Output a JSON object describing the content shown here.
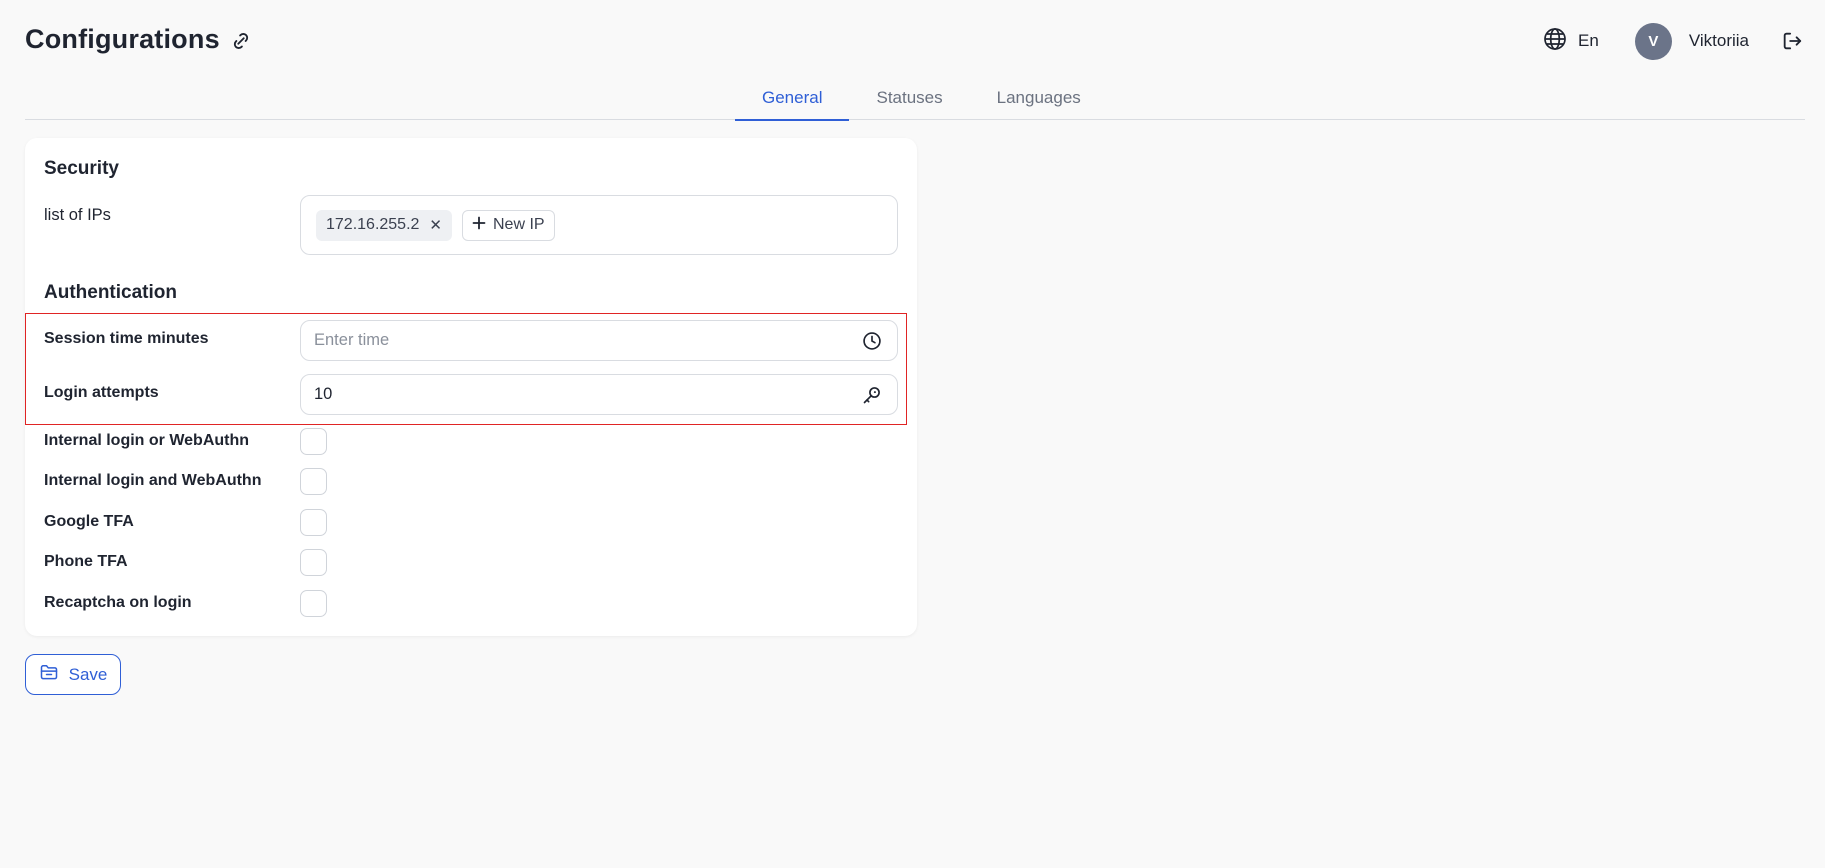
{
  "header": {
    "title": "Configurations",
    "language": "En",
    "user": {
      "initial": "V",
      "name": "Viktoriia"
    }
  },
  "tabs": [
    {
      "label": "General",
      "active": true
    },
    {
      "label": "Statuses",
      "active": false
    },
    {
      "label": "Languages",
      "active": false
    }
  ],
  "security": {
    "title": "Security",
    "ip_label": "list of IPs",
    "ips": [
      "172.16.255.2"
    ],
    "new_ip_label": "New IP"
  },
  "authentication": {
    "title": "Authentication",
    "session_time": {
      "label": "Session time minutes",
      "value": "",
      "placeholder": "Enter time"
    },
    "login_attempts": {
      "label": "Login attempts",
      "value": "10"
    },
    "options": [
      {
        "label": "Internal login or WebAuthn",
        "checked": false
      },
      {
        "label": "Internal login and WebAuthn",
        "checked": false
      },
      {
        "label": "Google TFA",
        "checked": false
      },
      {
        "label": "Phone TFA",
        "checked": false
      },
      {
        "label": "Recaptcha on login",
        "checked": false
      }
    ]
  },
  "actions": {
    "save_label": "Save"
  },
  "colors": {
    "accent": "#2f5fd6",
    "highlight": "#e02424",
    "avatar_bg": "#6b7489"
  }
}
